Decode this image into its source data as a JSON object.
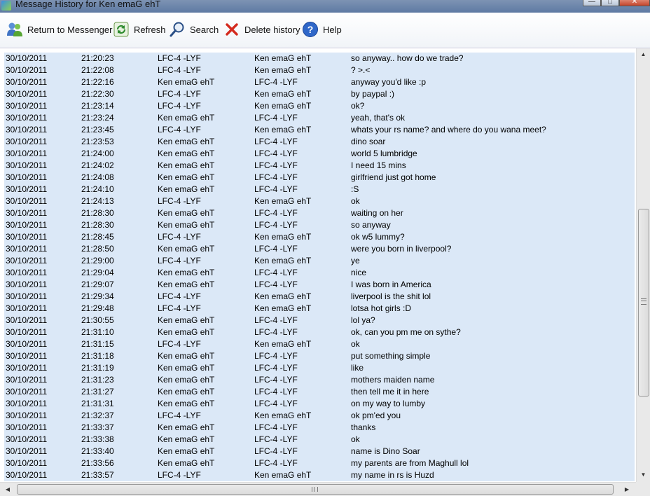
{
  "window": {
    "title": "Message History for Ken emaG ehT"
  },
  "toolbar": {
    "return_label": "Return to Messenger",
    "refresh_label": "Refresh",
    "search_label": "Search",
    "delete_label": "Delete history",
    "help_label": "Help"
  },
  "messages": [
    {
      "date": "30/10/2011",
      "time": "21:20:23",
      "from": "LFC-4 -LYF",
      "to": "Ken emaG ehT",
      "text": "so anyway.. how do we trade?"
    },
    {
      "date": "30/10/2011",
      "time": "21:22:08",
      "from": "LFC-4 -LYF",
      "to": "Ken emaG ehT",
      "text": "? >.<"
    },
    {
      "date": "30/10/2011",
      "time": "21:22:16",
      "from": "Ken emaG ehT",
      "to": "LFC-4 -LYF",
      "text": "anyway you'd like :p"
    },
    {
      "date": "30/10/2011",
      "time": "21:22:30",
      "from": "LFC-4 -LYF",
      "to": "Ken emaG ehT",
      "text": "by paypal :)"
    },
    {
      "date": "30/10/2011",
      "time": "21:23:14",
      "from": "LFC-4 -LYF",
      "to": "Ken emaG ehT",
      "text": "ok?"
    },
    {
      "date": "30/10/2011",
      "time": "21:23:24",
      "from": "Ken emaG ehT",
      "to": "LFC-4 -LYF",
      "text": "yeah, that's ok"
    },
    {
      "date": "30/10/2011",
      "time": "21:23:45",
      "from": "LFC-4 -LYF",
      "to": "Ken emaG ehT",
      "text": "whats your rs name? and where do you wana meet?"
    },
    {
      "date": "30/10/2011",
      "time": "21:23:53",
      "from": "Ken emaG ehT",
      "to": "LFC-4 -LYF",
      "text": "dino soar"
    },
    {
      "date": "30/10/2011",
      "time": "21:24:00",
      "from": "Ken emaG ehT",
      "to": "LFC-4 -LYF",
      "text": "world 5 lumbridge"
    },
    {
      "date": "30/10/2011",
      "time": "21:24:02",
      "from": "Ken emaG ehT",
      "to": "LFC-4 -LYF",
      "text": "I need 15 mins"
    },
    {
      "date": "30/10/2011",
      "time": "21:24:08",
      "from": "Ken emaG ehT",
      "to": "LFC-4 -LYF",
      "text": "girlfriend just got home"
    },
    {
      "date": "30/10/2011",
      "time": "21:24:10",
      "from": "Ken emaG ehT",
      "to": "LFC-4 -LYF",
      "text": ":S"
    },
    {
      "date": "30/10/2011",
      "time": "21:24:13",
      "from": "LFC-4 -LYF",
      "to": "Ken emaG ehT",
      "text": "ok"
    },
    {
      "date": "30/10/2011",
      "time": "21:28:30",
      "from": "Ken emaG ehT",
      "to": "LFC-4 -LYF",
      "text": "waiting on her"
    },
    {
      "date": "30/10/2011",
      "time": "21:28:30",
      "from": "Ken emaG ehT",
      "to": "LFC-4 -LYF",
      "text": "so anyway"
    },
    {
      "date": "30/10/2011",
      "time": "21:28:45",
      "from": "LFC-4 -LYF",
      "to": "Ken emaG ehT",
      "text": "ok w5 lummy?"
    },
    {
      "date": "30/10/2011",
      "time": "21:28:50",
      "from": "Ken emaG ehT",
      "to": "LFC-4 -LYF",
      "text": "were you born in liverpool?"
    },
    {
      "date": "30/10/2011",
      "time": "21:29:00",
      "from": "LFC-4 -LYF",
      "to": "Ken emaG ehT",
      "text": "ye"
    },
    {
      "date": "30/10/2011",
      "time": "21:29:04",
      "from": "Ken emaG ehT",
      "to": "LFC-4 -LYF",
      "text": "nice"
    },
    {
      "date": "30/10/2011",
      "time": "21:29:07",
      "from": "Ken emaG ehT",
      "to": "LFC-4 -LYF",
      "text": "I was born in America"
    },
    {
      "date": "30/10/2011",
      "time": "21:29:34",
      "from": "LFC-4 -LYF",
      "to": "Ken emaG ehT",
      "text": "liverpool is the shit lol"
    },
    {
      "date": "30/10/2011",
      "time": "21:29:48",
      "from": "LFC-4 -LYF",
      "to": "Ken emaG ehT",
      "text": "lotsa hot girls :D"
    },
    {
      "date": "30/10/2011",
      "time": "21:30:55",
      "from": "Ken emaG ehT",
      "to": "LFC-4 -LYF",
      "text": "lol ya?"
    },
    {
      "date": "30/10/2011",
      "time": "21:31:10",
      "from": "Ken emaG ehT",
      "to": "LFC-4 -LYF",
      "text": "ok, can you pm me on sythe?"
    },
    {
      "date": "30/10/2011",
      "time": "21:31:15",
      "from": "LFC-4 -LYF",
      "to": "Ken emaG ehT",
      "text": "ok"
    },
    {
      "date": "30/10/2011",
      "time": "21:31:18",
      "from": "Ken emaG ehT",
      "to": "LFC-4 -LYF",
      "text": "put something simple"
    },
    {
      "date": "30/10/2011",
      "time": "21:31:19",
      "from": "Ken emaG ehT",
      "to": "LFC-4 -LYF",
      "text": "like"
    },
    {
      "date": "30/10/2011",
      "time": "21:31:23",
      "from": "Ken emaG ehT",
      "to": "LFC-4 -LYF",
      "text": "mothers maiden name"
    },
    {
      "date": "30/10/2011",
      "time": "21:31:27",
      "from": "Ken emaG ehT",
      "to": "LFC-4 -LYF",
      "text": "then tell me it in here"
    },
    {
      "date": "30/10/2011",
      "time": "21:31:31",
      "from": "Ken emaG ehT",
      "to": "LFC-4 -LYF",
      "text": "on my way to lumby"
    },
    {
      "date": "30/10/2011",
      "time": "21:32:37",
      "from": "LFC-4 -LYF",
      "to": "Ken emaG ehT",
      "text": "ok pm'ed you"
    },
    {
      "date": "30/10/2011",
      "time": "21:33:37",
      "from": "Ken emaG ehT",
      "to": "LFC-4 -LYF",
      "text": "thanks"
    },
    {
      "date": "30/10/2011",
      "time": "21:33:38",
      "from": "Ken emaG ehT",
      "to": "LFC-4 -LYF",
      "text": "ok"
    },
    {
      "date": "30/10/2011",
      "time": "21:33:40",
      "from": "Ken emaG ehT",
      "to": "LFC-4 -LYF",
      "text": "name is Dino Soar"
    },
    {
      "date": "30/10/2011",
      "time": "21:33:56",
      "from": "Ken emaG ehT",
      "to": "LFC-4 -LYF",
      "text": "my parents are from Maghull lol"
    },
    {
      "date": "30/10/2011",
      "time": "21:33:57",
      "from": "LFC-4 -LYF",
      "to": "Ken emaG ehT",
      "text": "my name in rs is Huzd"
    }
  ]
}
